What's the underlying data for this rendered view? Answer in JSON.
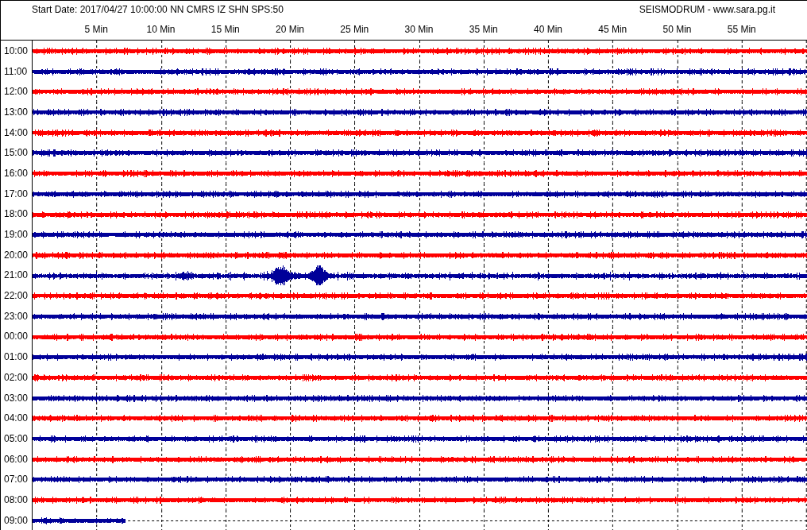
{
  "header": {
    "title": "Start Date: 2017/04/27 10:00:00 NN CMRS IZ SHN SPS:50",
    "brand": "SEISMODRUM - www.sara.pg.it"
  },
  "minute_labels": [
    "5 Min",
    "10 Min",
    "15 Min",
    "20 Min",
    "25 Min",
    "30 Min",
    "35 Min",
    "40 Min",
    "45 Min",
    "50 Min",
    "55 Min"
  ],
  "rows": [
    {
      "hour": "10:00",
      "color": "#ff0000",
      "kind": "full"
    },
    {
      "hour": "11:00",
      "color": "#000099",
      "kind": "full"
    },
    {
      "hour": "12:00",
      "color": "#ff0000",
      "kind": "full"
    },
    {
      "hour": "13:00",
      "color": "#000099",
      "kind": "full"
    },
    {
      "hour": "14:00",
      "color": "#ff0000",
      "kind": "full"
    },
    {
      "hour": "15:00",
      "color": "#000099",
      "kind": "full"
    },
    {
      "hour": "16:00",
      "color": "#ff0000",
      "kind": "full"
    },
    {
      "hour": "17:00",
      "color": "#000099",
      "kind": "full"
    },
    {
      "hour": "18:00",
      "color": "#ff0000",
      "kind": "full"
    },
    {
      "hour": "19:00",
      "color": "#000099",
      "kind": "full"
    },
    {
      "hour": "20:00",
      "color": "#ff0000",
      "kind": "full"
    },
    {
      "hour": "21:00",
      "color": "#000099",
      "kind": "event"
    },
    {
      "hour": "22:00",
      "color": "#ff0000",
      "kind": "full"
    },
    {
      "hour": "23:00",
      "color": "#000099",
      "kind": "full"
    },
    {
      "hour": "00:00",
      "color": "#ff0000",
      "kind": "full"
    },
    {
      "hour": "01:00",
      "color": "#000099",
      "kind": "full"
    },
    {
      "hour": "02:00",
      "color": "#ff0000",
      "kind": "full"
    },
    {
      "hour": "03:00",
      "color": "#000099",
      "kind": "full"
    },
    {
      "hour": "04:00",
      "color": "#ff0000",
      "kind": "full"
    },
    {
      "hour": "05:00",
      "color": "#000099",
      "kind": "full"
    },
    {
      "hour": "06:00",
      "color": "#ff0000",
      "kind": "full"
    },
    {
      "hour": "07:00",
      "color": "#000099",
      "kind": "full"
    },
    {
      "hour": "08:00",
      "color": "#ff0000",
      "kind": "full"
    },
    {
      "hour": "09:00",
      "color": "#000099",
      "kind": "partial"
    }
  ]
}
